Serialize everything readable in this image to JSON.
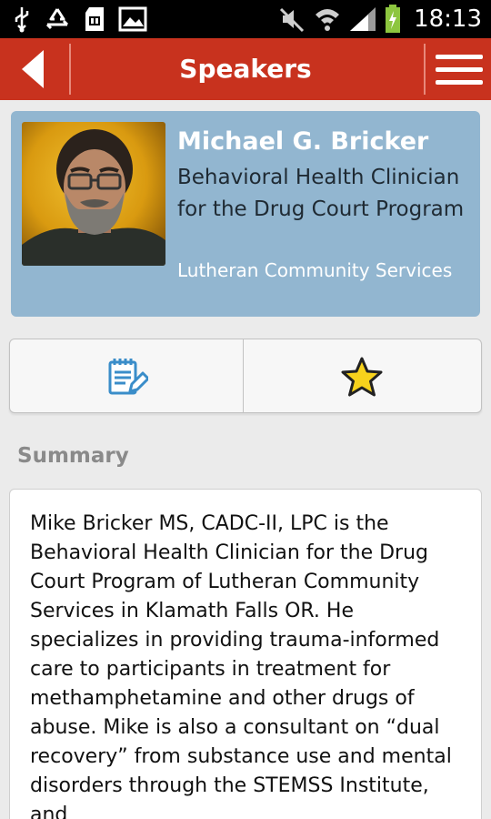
{
  "status_bar": {
    "time": "18:13",
    "icons": [
      "usb-icon",
      "recycle-icon",
      "sd-card-icon",
      "image-icon",
      "mute-icon",
      "wifi-icon",
      "signal-icon",
      "battery-charging-icon"
    ]
  },
  "action_bar": {
    "title": "Speakers",
    "back_icon": "back-arrow-icon",
    "menu_icon": "hamburger-menu-icon",
    "color": "#c8321e"
  },
  "speaker": {
    "name": "Michael G. Bricker",
    "title": "Behavioral Health Clinician for the Drug Court Program",
    "organization": "Lutheran Community Services",
    "card_color": "#92b6d0"
  },
  "actions": {
    "notes_icon": "notes-edit-icon",
    "favorite_icon": "star-icon"
  },
  "summary": {
    "label": "Summary",
    "text": "Mike Bricker MS, CADC-II, LPC is the Behavioral Health Clinician for the Drug Court Program of Lutheran Community Services in Klamath Falls OR. He specializes in providing trauma-informed care to participants in treatment for methamphetamine and other drugs of abuse. Mike is also a consultant on “dual recovery” from substance use and mental disorders through the STEMSS Institute, and"
  }
}
